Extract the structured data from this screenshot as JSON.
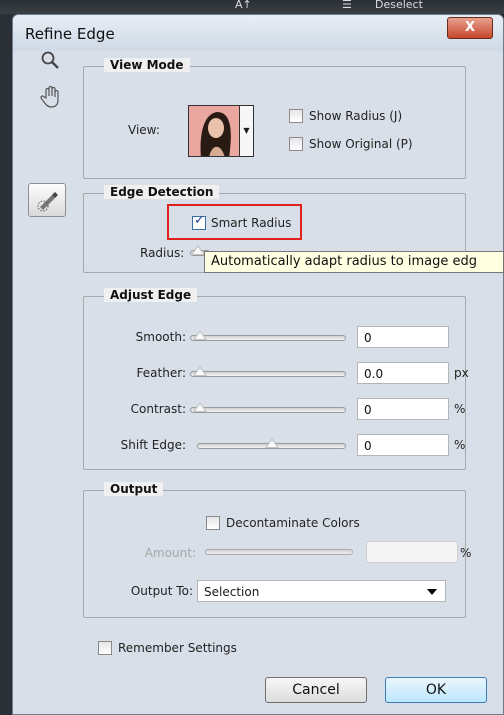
{
  "app_menu": {
    "item_a": "A↑",
    "item_deselect": "Deselect"
  },
  "window": {
    "title": "Refine Edge",
    "close_glyph": "X"
  },
  "tools": {
    "zoom": "zoom-icon",
    "hand": "hand-icon",
    "refine_brush": "refine-radius-brush-icon"
  },
  "view_mode": {
    "title": "View Mode",
    "view_label": "View:",
    "show_radius_label": "Show Radius (J)",
    "show_radius_checked": false,
    "show_original_label": "Show Original (P)",
    "show_original_checked": false
  },
  "edge_detection": {
    "title": "Edge Detection",
    "smart_radius_label": "Smart Radius",
    "smart_radius_checked": true,
    "radius_label": "Radius:",
    "tooltip": "Automatically adapt radius to image edg"
  },
  "adjust_edge": {
    "title": "Adjust Edge",
    "smooth": {
      "label": "Smooth:",
      "value": "0",
      "unit": ""
    },
    "feather": {
      "label": "Feather:",
      "value": "0.0",
      "unit": "px"
    },
    "contrast": {
      "label": "Contrast:",
      "value": "0",
      "unit": "%"
    },
    "shift_edge": {
      "label": "Shift Edge:",
      "value": "0",
      "unit": "%"
    }
  },
  "output": {
    "title": "Output",
    "decontaminate_label": "Decontaminate Colors",
    "decontaminate_checked": false,
    "amount_label": "Amount:",
    "amount_value": "",
    "amount_unit": "%",
    "output_to_label": "Output To:",
    "output_to_value": "Selection"
  },
  "remember_settings_label": "Remember Settings",
  "buttons": {
    "cancel": "Cancel",
    "ok": "OK"
  },
  "colors": {
    "highlight": "#e0201b",
    "tooltip_bg": "#ffffe1",
    "ok_bg": "#bee6fd"
  }
}
